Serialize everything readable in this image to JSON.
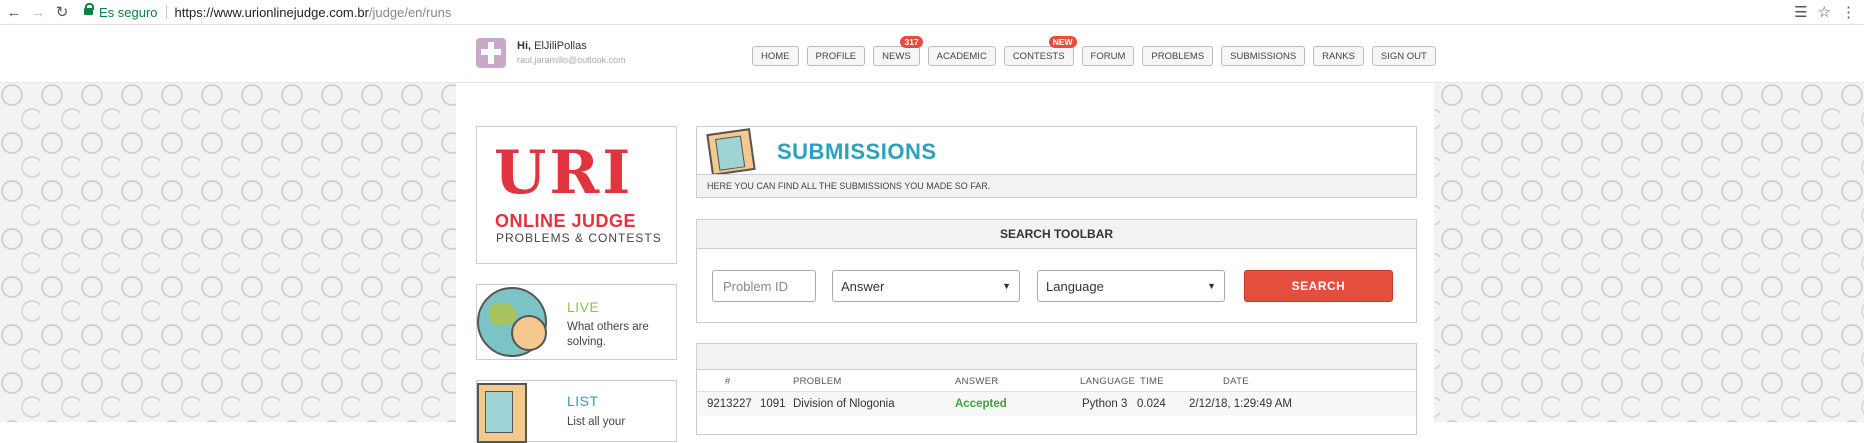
{
  "browser": {
    "back_icon": "arrow-left-icon",
    "secure_label": "Es seguro",
    "url_host": "https://www.urionlinejudge.com.br",
    "url_path": "/judge/en/runs"
  },
  "header": {
    "greeting_prefix": "Hi,",
    "username": "ElJiliPollas",
    "email": "raul.jaramillo@outlook.com",
    "nav": [
      {
        "label": "HOME"
      },
      {
        "label": "PROFILE"
      },
      {
        "label": "NEWS",
        "badge": "317"
      },
      {
        "label": "ACADEMIC"
      },
      {
        "label": "CONTESTS",
        "badge": "NEW"
      },
      {
        "label": "FORUM"
      },
      {
        "label": "PROBLEMS"
      },
      {
        "label": "SUBMISSIONS"
      },
      {
        "label": "RANKS"
      },
      {
        "label": "SIGN OUT"
      }
    ]
  },
  "sidebar": {
    "logo_main": "URI",
    "logo_sub1": "ONLINE JUDGE",
    "logo_sub2": "PROBLEMS & CONTESTS",
    "live_title": "LIVE",
    "live_desc": "What others are solving.",
    "list_title": "LIST",
    "list_desc": "List all your"
  },
  "submissions": {
    "title": "SUBMISSIONS",
    "description": "HERE YOU CAN FIND ALL THE SUBMISSIONS YOU MADE SO FAR."
  },
  "search": {
    "title": "SEARCH TOOLBAR",
    "problem_id_placeholder": "Problem ID",
    "answer_selected": "Answer",
    "language_selected": "Language",
    "button_label": "SEARCH"
  },
  "table": {
    "headers": [
      "#",
      "PROBLEM",
      "ANSWER",
      "LANGUAGE",
      "TIME",
      "DATE"
    ],
    "rows": [
      {
        "id": "9213227",
        "problem_num": "1091",
        "problem_name": "Division of Nlogonia",
        "answer": "Accepted",
        "language": "Python 3",
        "time": "0.024",
        "date": "2/12/18, 1:29:49 AM"
      }
    ]
  },
  "colors": {
    "accent_red": "#e54d3f",
    "brand_teal": "#2aa1c0",
    "live_green": "#8cc63f",
    "accepted_green": "#3aa53a",
    "secure_green": "#0b8043"
  }
}
